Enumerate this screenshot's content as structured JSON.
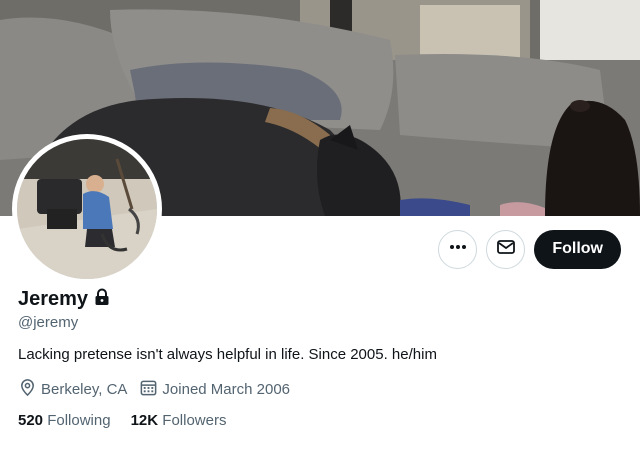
{
  "profile": {
    "display_name": "Jeremy",
    "handle": "@jeremy",
    "bio": "Lacking pretense isn't always helpful in life. Since 2005. he/him",
    "location": "Berkeley, CA",
    "joined": "Joined March 2006",
    "following_count": "520",
    "following_label": "Following",
    "followers_count": "12K",
    "followers_label": "Followers",
    "locked": true
  },
  "actions": {
    "more_icon": "more-horizontal-icon",
    "message_icon": "envelope-icon",
    "follow_label": "Follow"
  },
  "icons": {
    "location": "location-pin-icon",
    "calendar": "calendar-icon",
    "lock": "lock-icon"
  },
  "colors": {
    "text_primary": "#0f1419",
    "text_secondary": "#536471",
    "follow_bg": "#0f1419",
    "border": "#cfd9de"
  }
}
